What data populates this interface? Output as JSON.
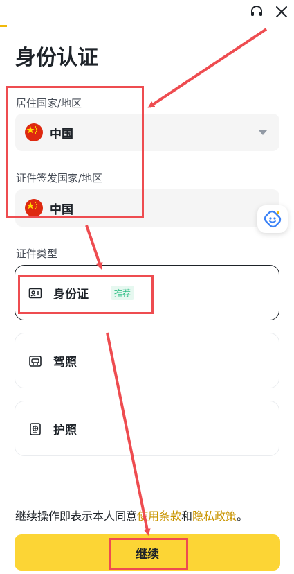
{
  "title": "身份认证",
  "residence": {
    "label": "居住国家/地区",
    "value": "中国"
  },
  "issuing": {
    "label": "证件签发国家/地区",
    "value": "中国"
  },
  "doc_type": {
    "label": "证件类型",
    "options": [
      {
        "label": "身份证",
        "badge": "推荐",
        "icon": "id-card-icon",
        "selected": true
      },
      {
        "label": "驾照",
        "icon": "drivers-license-icon"
      },
      {
        "label": "护照",
        "icon": "passport-icon"
      }
    ]
  },
  "terms": {
    "prefix": "继续操作即表示本人同意",
    "link1": "使用条款",
    "and": "和",
    "link2": "隐私政策",
    "suffix": "。"
  },
  "continue_label": "继续",
  "colors": {
    "accent": "#fcd535",
    "link": "#c99400",
    "annotation": "#ee4c50",
    "badge": "#2ebd85"
  },
  "icons": [
    "headset-icon",
    "close-icon",
    "chevron-down-icon",
    "ai-assistant-icon",
    "china-flag-icon"
  ]
}
